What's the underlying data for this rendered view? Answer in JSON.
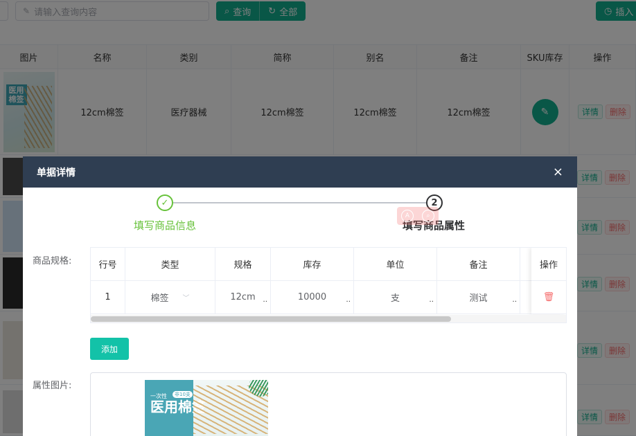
{
  "toolbar": {
    "search_placeholder": "请输入查询内容",
    "query_label": "查询",
    "all_label": "全部",
    "insert_label": "插入"
  },
  "grid": {
    "headers": [
      "图片",
      "名称",
      "类别",
      "简称",
      "别名",
      "备注",
      "SKU库存",
      "操作"
    ],
    "row1": {
      "name": "12cm棉签",
      "category": "医疗器械",
      "short_name": "12cm棉签",
      "alias": "12cm棉签",
      "remark": "12cm棉签",
      "thumb_text": "医用棉签"
    },
    "detail_label": "详情",
    "delete_label": "删除"
  },
  "dialog": {
    "title": "单据详情",
    "close": "×",
    "steps": [
      {
        "label": "填写商品信息",
        "icon": "check-icon",
        "status": "finished"
      },
      {
        "label": "填写商品属性",
        "number": "2",
        "status": "active"
      }
    ],
    "spec_label": "商品规格:",
    "attr_img_label": "属性图片:",
    "spec_table": {
      "headers": [
        "行号",
        "类型",
        "规格",
        "库存",
        "单位",
        "备注",
        "操作"
      ],
      "rows": [
        {
          "no": "1",
          "type": "棉签",
          "spec": "12cm",
          "stock": "10000",
          "unit": "支",
          "remark": "测试"
        }
      ]
    },
    "add_label": "添加",
    "attr_image": {
      "line1": "一次性",
      "badge": "非10支",
      "title": "医用棉签"
    }
  },
  "colors": {
    "accent": "#13ae8e",
    "header_bg": "#2f3e52",
    "success": "#67c23a",
    "danger": "#f56c6c"
  }
}
